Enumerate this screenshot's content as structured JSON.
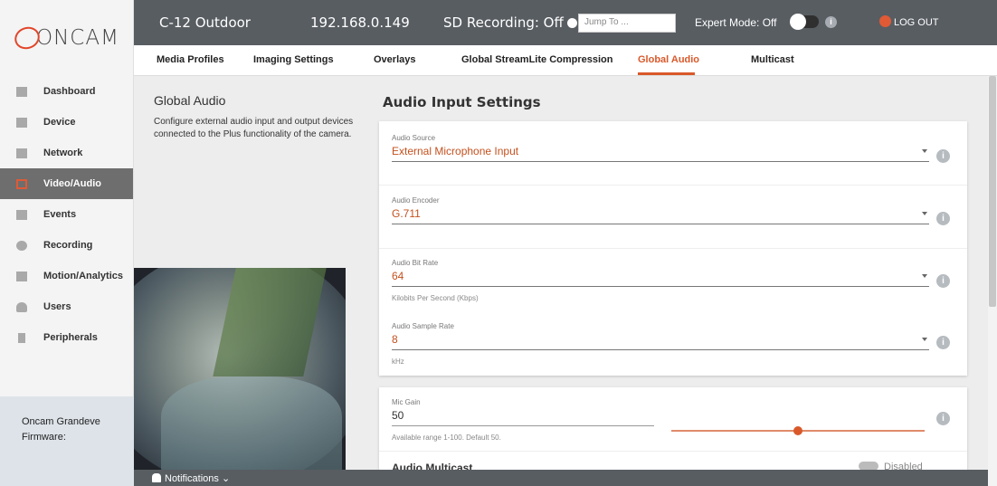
{
  "brand": {
    "logo_text": "ONCAM",
    "accent": "#e2462a"
  },
  "sidebar": {
    "items": [
      {
        "label": "Dashboard",
        "icon": "grid-icon"
      },
      {
        "label": "Device",
        "icon": "camera-icon"
      },
      {
        "label": "Network",
        "icon": "network-icon"
      },
      {
        "label": "Video/Audio",
        "icon": "video-icon",
        "active": true
      },
      {
        "label": "Events",
        "icon": "calendar-icon"
      },
      {
        "label": "Recording",
        "icon": "record-icon"
      },
      {
        "label": "Motion/Analytics",
        "icon": "chart-icon"
      },
      {
        "label": "Users",
        "icon": "user-icon"
      },
      {
        "label": "Peripherals",
        "icon": "usb-icon"
      }
    ],
    "device_name": "Oncam Grandeve",
    "firmware_label": "Firmware:"
  },
  "topbar": {
    "camera_name": "C-12 Outdoor",
    "ip": "192.168.0.149",
    "sd_recording": "SD Recording: Off",
    "jump_placeholder": "Jump To ...",
    "expert_mode": "Expert Mode: Off",
    "logout": "LOG OUT"
  },
  "tabs": [
    "Media Profiles",
    "Imaging Settings",
    "Overlays",
    "Global StreamLite Compression",
    "Global Audio",
    "Multicast"
  ],
  "active_tab": "Global Audio",
  "info": {
    "title": "Global Audio",
    "description": "Configure external audio input and output devices connected to the Plus functionality of the camera."
  },
  "audio_input": {
    "title": "Audio Input Settings",
    "source": {
      "label": "Audio Source",
      "value": "External Microphone Input"
    },
    "encoder": {
      "label": "Audio Encoder",
      "value": "G.711"
    },
    "bitrate": {
      "label": "Audio Bit Rate",
      "value": "64",
      "hint": "Kilobits Per Second (Kbps)"
    },
    "sample_rate": {
      "label": "Audio Sample Rate",
      "value": "8",
      "hint": "kHz"
    },
    "mic_gain": {
      "label": "Mic Gain",
      "value": "50",
      "hint": "Available range 1-100. Default 50.",
      "level": 0.5
    },
    "multicast": {
      "label": "Audio Multicast",
      "status": "Disabled"
    }
  },
  "notifications": {
    "label": "Notifications"
  }
}
